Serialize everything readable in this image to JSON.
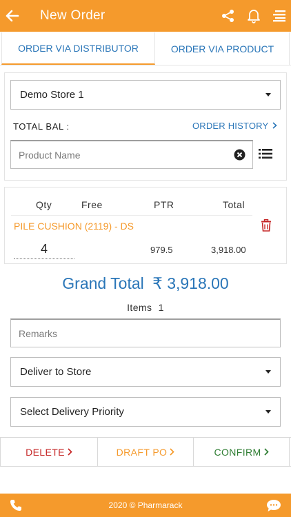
{
  "header": {
    "title": "New Order",
    "icons": [
      "back-arrow-icon",
      "share-icon",
      "bell-icon",
      "menu-icon"
    ]
  },
  "tabs": [
    {
      "label": "ORDER VIA DISTRIBUTOR",
      "active": true
    },
    {
      "label": "ORDER VIA PRODUCT",
      "active": false
    }
  ],
  "store_select": {
    "value": "Demo Store 1"
  },
  "balance": {
    "label": "TOTAL BAL :"
  },
  "order_history": {
    "label": "ORDER HISTORY"
  },
  "product_search": {
    "placeholder": "Product Name"
  },
  "table": {
    "headers": {
      "qty": "Qty",
      "free": "Free",
      "ptr": "PTR",
      "total": "Total"
    },
    "row": {
      "name": "PILE CUSHION (2119) - DS",
      "qty": "4",
      "ptr": "979.5",
      "total": "3,918.00"
    }
  },
  "grand_total": {
    "label": "Grand Total",
    "currency": "₹",
    "value": "3,918.00"
  },
  "items": {
    "label": "Items",
    "count": "1"
  },
  "remarks": {
    "placeholder": "Remarks"
  },
  "deliver_select": {
    "value": "Deliver to Store"
  },
  "priority_select": {
    "value": "Select Delivery Priority"
  },
  "actions": {
    "delete": {
      "label": "DELETE",
      "color": "#c62828"
    },
    "draft": {
      "label": "DRAFT PO",
      "color": "#f59a2c"
    },
    "confirm": {
      "label": "CONFIRM",
      "color": "#2e7d32"
    }
  },
  "footer": {
    "text": "2020 © Pharmarack",
    "icons": [
      "phone-icon",
      "chat-icon"
    ]
  },
  "colors": {
    "brand": "#f59a2c",
    "link": "#2a76b8",
    "border": "#bdbdbd"
  }
}
